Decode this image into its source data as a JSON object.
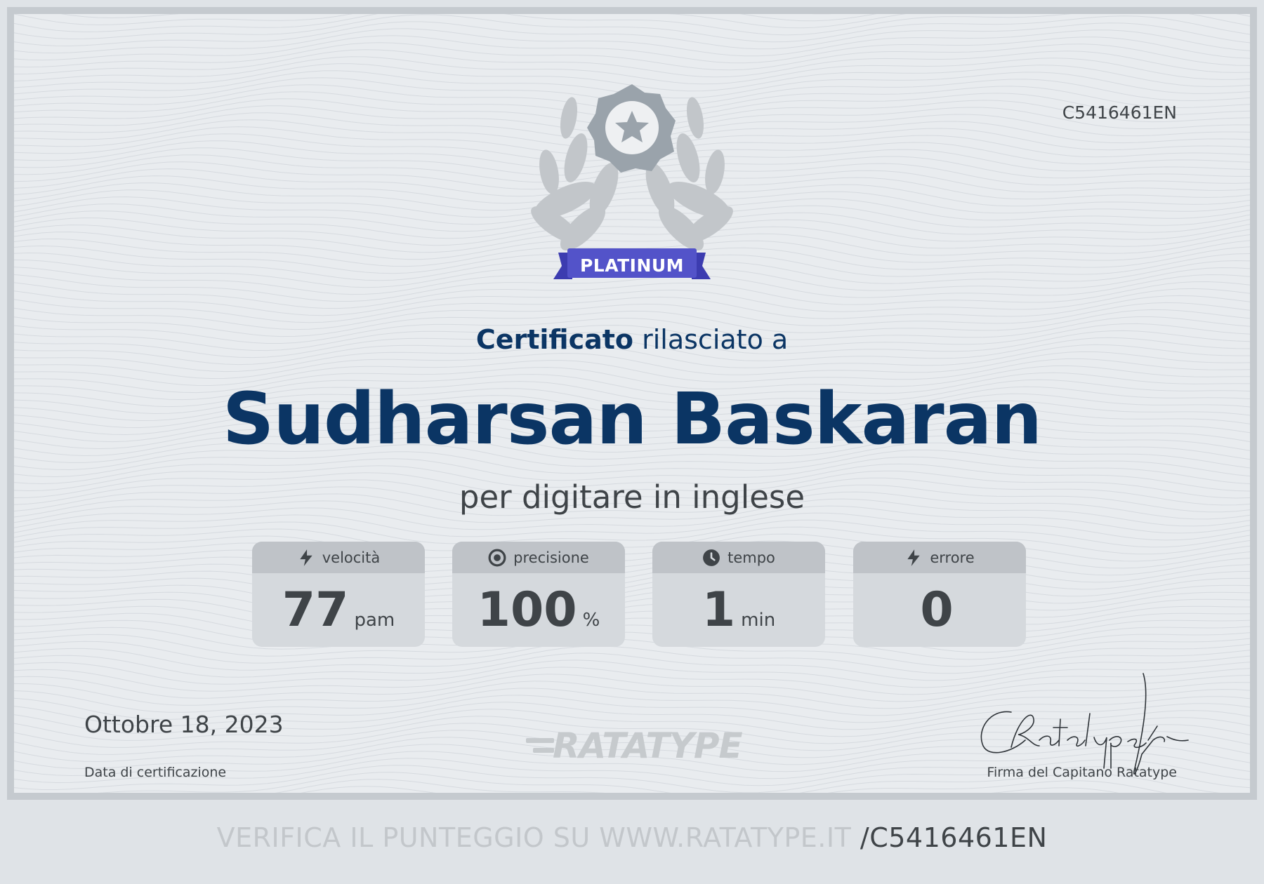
{
  "certificate": {
    "code": "C5416461EN",
    "badge_label": "PLATINUM",
    "issued_bold": "Certificato",
    "issued_rest": "rilasciato a",
    "recipient_name": "Sudharsan Baskaran",
    "subject": "per digitare in inglese",
    "stats": [
      {
        "icon": "lightning-icon",
        "label": "velocità",
        "value": "77",
        "unit": "pam"
      },
      {
        "icon": "target-icon",
        "label": "precisione",
        "value": "100",
        "unit": "%"
      },
      {
        "icon": "clock-icon",
        "label": "tempo",
        "value": "1",
        "unit": "min"
      },
      {
        "icon": "lightning-icon",
        "label": "errore",
        "value": "0",
        "unit": ""
      }
    ],
    "date": "Ottobre 18, 2023",
    "date_label": "Data di certificazione",
    "logo_text": "RATATYPE",
    "signature_label": "Firma del Capitano Ratatype"
  },
  "footer": {
    "verify_text": "VERIFICA IL PUNTEGGIO SU WWW.RATATYPE.IT",
    "verify_id": "/C5416461EN"
  },
  "colors": {
    "navy": "#0b3564",
    "ribbon": "#5353c9",
    "medal": "#9aa3ab",
    "text": "#3f4448"
  }
}
